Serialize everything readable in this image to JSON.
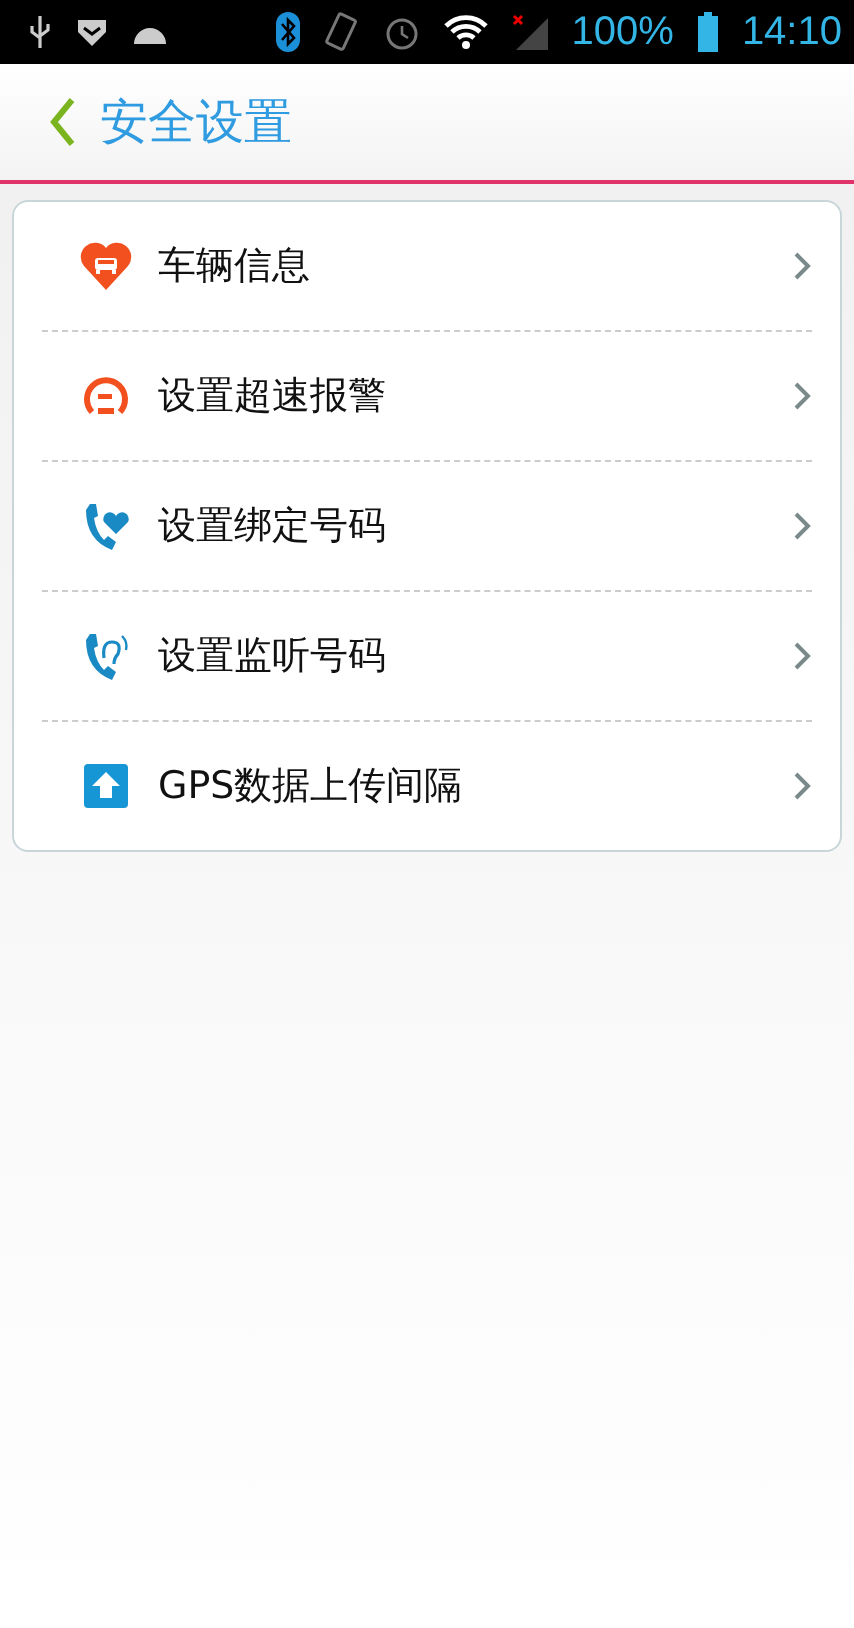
{
  "status_bar": {
    "battery": "100%",
    "time": "14:10"
  },
  "header": {
    "title": "安全设置"
  },
  "items": [
    {
      "kind": "vehicle",
      "label": "车辆信息"
    },
    {
      "kind": "speed",
      "label": "设置超速报警"
    },
    {
      "kind": "bind",
      "label": "设置绑定号码"
    },
    {
      "kind": "listen",
      "label": "设置监听号码"
    },
    {
      "kind": "upload",
      "label": "GPS数据上传间隔"
    }
  ]
}
